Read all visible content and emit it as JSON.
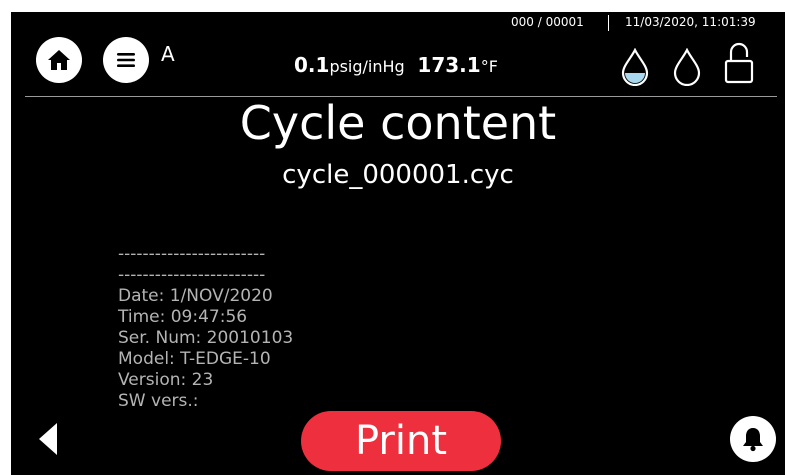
{
  "header": {
    "counter": "000 / 00001",
    "datetime": "11/03/2020, 11:01:39",
    "mode_label": "A",
    "pressure_value": "0.1",
    "pressure_unit": "psig/inHg",
    "temperature_value": "173.1",
    "temperature_unit": "°F",
    "icons": [
      "home-icon",
      "menu-icon",
      "water-drop-filled-icon",
      "water-drop-icon",
      "lock-open-icon"
    ]
  },
  "main": {
    "title": "Cycle content",
    "filename": "cycle_000001.cyc",
    "content_lines": [
      "------------------------",
      "------------------------",
      "Date: 1/NOV/2020",
      "Time: 09:47:56",
      "Ser. Num: 20010103",
      "Model: T-EDGE-10",
      "Version: 23",
      "SW vers.:"
    ]
  },
  "footer": {
    "print_label": "Print",
    "icons": [
      "back-arrow-icon",
      "bell-icon"
    ]
  },
  "colors": {
    "background": "#000000",
    "print_button": "#ee2f3d",
    "text": "#ffffff",
    "content_text": "#b4b4b4",
    "drop_fill": "#a9d8ee"
  }
}
